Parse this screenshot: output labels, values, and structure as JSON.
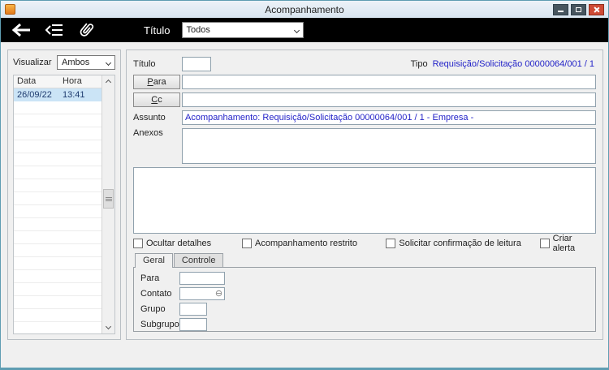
{
  "window": {
    "title": "Acompanhamento"
  },
  "toolbar": {
    "titulo_label": "Título",
    "filter_value": "Todos"
  },
  "left_panel": {
    "visualizar_label": "Visualizar",
    "visualizar_value": "Ambos",
    "columns": {
      "data": "Data",
      "hora": "Hora"
    },
    "rows": [
      {
        "data": "26/09/22",
        "hora": "13:41"
      }
    ]
  },
  "form": {
    "titulo_label": "Título",
    "titulo_value": "",
    "tipo_label": "Tipo",
    "tipo_value": "Requisição/Solicitação 00000064/001 / 1",
    "para_label": "Para",
    "para_value": "",
    "cc_label": "Cc",
    "cc_value": "",
    "assunto_label": "Assunto",
    "assunto_value": "Acompanhamento: Requisição/Solicitação 00000064/001 / 1 - Empresa  -",
    "anexos_label": "Anexos",
    "message_value": "",
    "checkboxes": [
      "Ocultar detalhes",
      "Acompanhamento restrito",
      "Solicitar confirmação de leitura",
      "Criar alerta"
    ],
    "tabs": [
      {
        "label": "Geral",
        "active": true
      },
      {
        "label": "Controle",
        "active": false
      }
    ],
    "detail_fields": [
      {
        "label": "Para",
        "value": ""
      },
      {
        "label": "Contato",
        "value": ""
      },
      {
        "label": "Grupo",
        "value": ""
      },
      {
        "label": "Subgrupo",
        "value": ""
      }
    ]
  },
  "colors": {
    "link_blue": "#2323c8",
    "selection_blue": "#cbe4f6",
    "toolbar_black": "#000000",
    "close_red": "#ce4a35"
  }
}
